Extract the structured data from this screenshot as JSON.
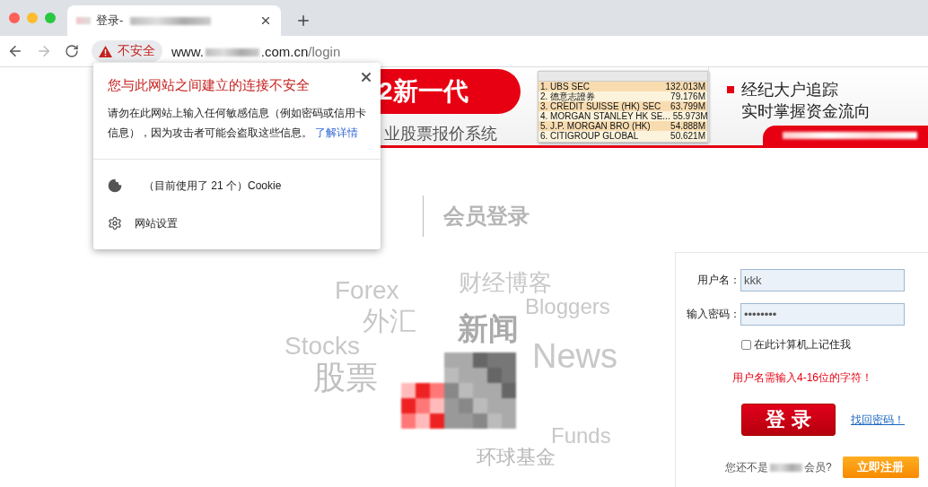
{
  "browser": {
    "tab": {
      "title": "登录-",
      "selected": true
    },
    "forward_disabled": true,
    "security_chip": "不安全",
    "url": {
      "prefix": "www.",
      "domain_suffix": ".com.cn",
      "path": "/login"
    }
  },
  "popup": {
    "title": "您与此网站之间建立的连接不安全",
    "body": "请勿在此网站上输入任何敏感信息（例如密码或信用卡信息），因为攻击者可能会盗取这些信息。",
    "link": "了解详情",
    "items": [
      {
        "kind": "cookie",
        "label": "（目前使用了 21 个）Cookie"
      },
      {
        "kind": "settings",
        "label": "网站设置"
      }
    ]
  },
  "banner": {
    "headline": "2新一代",
    "subtitle": "业股票报价系统",
    "table_rows": [
      {
        "broker": "1. UBS SEC",
        "amount": "132.013M"
      },
      {
        "broker": "2. 德意志證券",
        "amount": "79.176M"
      },
      {
        "broker": "3. CREDIT SUISSE (HK) SEC",
        "amount": "63.799M"
      },
      {
        "broker": "4. MORGAN STANLEY HK SE...",
        "amount": "55.973M"
      },
      {
        "broker": "5. J.P. MORGAN BRO (HK)",
        "amount": "54.888M"
      },
      {
        "broker": "6. CITIGROUP GLOBAL",
        "amount": "50.621M"
      }
    ],
    "tagline_lines": [
      "经纪大户追踪",
      "实时掌握资金流向"
    ]
  },
  "heading": "会员登录",
  "word_cloud": [
    {
      "text": "Forex"
    },
    {
      "text": "外汇"
    },
    {
      "text": "Stocks"
    },
    {
      "text": "股票"
    },
    {
      "text": "财经博客"
    },
    {
      "text": "Bloggers"
    },
    {
      "text": "新闻"
    },
    {
      "text": "News"
    },
    {
      "text": "Funds"
    },
    {
      "text": "环球基金"
    }
  ],
  "login": {
    "username_label": "用户名：",
    "username": "kkk",
    "password_label": "输入密码：",
    "password": "••••••••",
    "remember": {
      "label": "在此计算机上记住我",
      "checked": false
    },
    "error": "用户名需输入4-16位的字符！",
    "submit": "登 录",
    "forgot": "找回密码！",
    "register_prompt_start": "您还不是",
    "register_prompt_end": "会员?",
    "register": "立即注册"
  }
}
